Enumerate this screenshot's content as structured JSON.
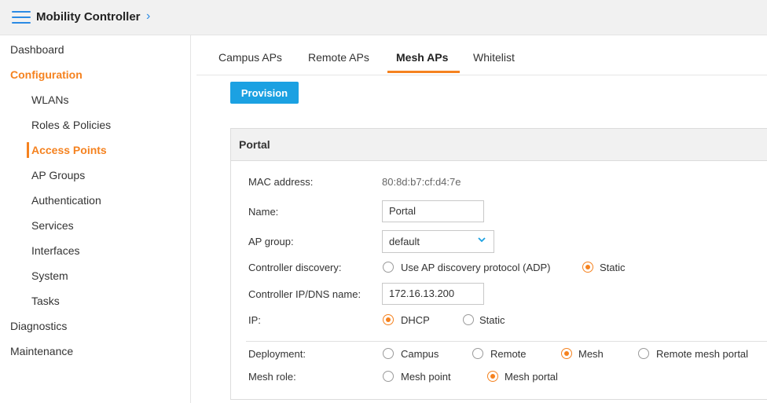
{
  "header": {
    "title": "Mobility Controller",
    "chevron_icon": "chevron-right-icon",
    "menu_icon": "hamburger-menu-icon",
    "accent": "#2a8ae4"
  },
  "sidebar": {
    "items": [
      {
        "label": "Dashboard"
      },
      {
        "label": "Configuration"
      },
      {
        "label": "WLANs"
      },
      {
        "label": "Roles & Policies"
      },
      {
        "label": "Access Points"
      },
      {
        "label": "AP Groups"
      },
      {
        "label": "Authentication"
      },
      {
        "label": "Services"
      },
      {
        "label": "Interfaces"
      },
      {
        "label": "System"
      },
      {
        "label": "Tasks"
      },
      {
        "label": "Diagnostics"
      },
      {
        "label": "Maintenance"
      }
    ],
    "active_color": "#f5821f"
  },
  "tabs": [
    {
      "label": "Campus APs"
    },
    {
      "label": "Remote APs"
    },
    {
      "label": "Mesh APs"
    },
    {
      "label": "Whitelist"
    }
  ],
  "provision_button": "Provision",
  "panel": {
    "title": "Portal",
    "mac_label": "MAC address:",
    "mac_value": "80:8d:b7:cf:d4:7e",
    "name_label": "Name:",
    "name_value": "Portal",
    "ap_group_label": "AP group:",
    "ap_group_value": "default",
    "discovery_label": "Controller discovery:",
    "discovery_options": [
      "Use AP discovery protocol (ADP)",
      "Static"
    ],
    "discovery_selected": "Static",
    "controller_ip_label": "Controller IP/DNS name:",
    "controller_ip_value": "172.16.13.200",
    "ip_label": "IP:",
    "ip_options": [
      "DHCP",
      "Static"
    ],
    "ip_selected": "DHCP",
    "deployment_label": "Deployment:",
    "deployment_options": [
      "Campus",
      "Remote",
      "Mesh",
      "Remote mesh portal"
    ],
    "deployment_selected": "Mesh",
    "mesh_role_label": "Mesh role:",
    "mesh_role_options": [
      "Mesh point",
      "Mesh portal"
    ],
    "mesh_role_selected": "Mesh portal"
  }
}
